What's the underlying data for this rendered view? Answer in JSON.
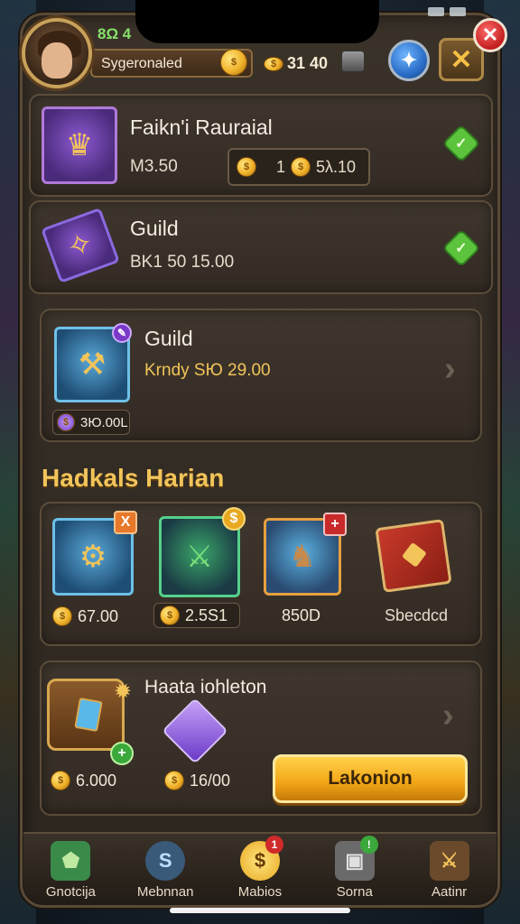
{
  "header": {
    "level": "8Ω 4",
    "player_name": "Sygeronaled",
    "gold": "31 40"
  },
  "offers": [
    {
      "title": "Faikn'i Rauraial",
      "price": "M3.50",
      "qty": "1",
      "cost": "5λ.10"
    },
    {
      "title": "Guild",
      "price": "BK1 50 15.00"
    },
    {
      "title": "Guild",
      "price": "Krndy SЮ 29.00",
      "tag": "3Ю.00L"
    }
  ],
  "section": {
    "title": "Hadkals Harian"
  },
  "items": [
    {
      "price": "67.00",
      "badge": "X"
    },
    {
      "price": "2.5S1",
      "badge": "$"
    },
    {
      "price": "850D",
      "badge": "+"
    },
    {
      "price": "Sbecdcd"
    }
  ],
  "chest_panel": {
    "title": "Haata iohleton",
    "price_left": "6.000",
    "price_right": "16/00",
    "cta_label": "Lakonion"
  },
  "nav": [
    {
      "label": "Gnotcija"
    },
    {
      "label": "Mebnnan"
    },
    {
      "label": "Mabios",
      "badge": "1"
    },
    {
      "label": "Sorna",
      "badge": "!"
    },
    {
      "label": "Aatinr"
    }
  ],
  "colors": {
    "accent_gold": "#f2c45a",
    "confirm_green": "#5bc43c",
    "cta_yellow": "#f2a516",
    "close_red": "#c21e1e"
  },
  "icons": [
    "avatar",
    "coin-icon",
    "gold-pile-icon",
    "stack-icon",
    "refresh-icon",
    "close-icon",
    "check-icon",
    "chevron-right-icon"
  ]
}
